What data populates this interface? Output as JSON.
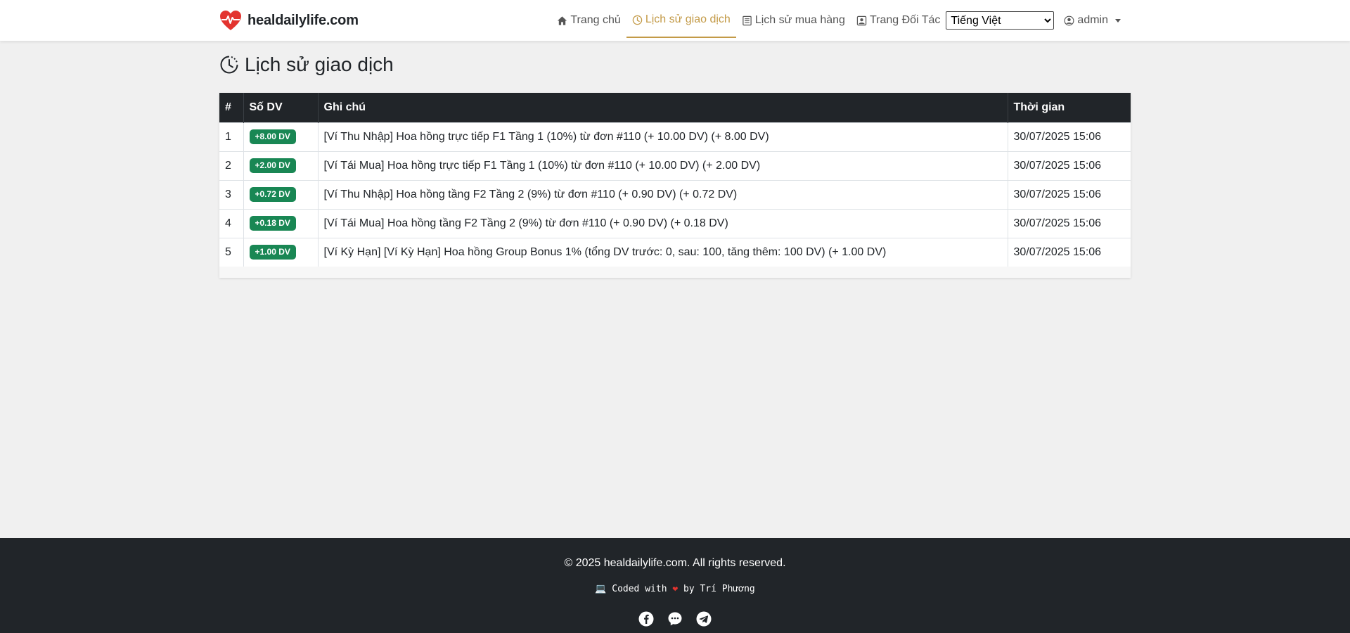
{
  "navbar": {
    "brand": "healdailylife.com",
    "links": [
      {
        "label": "Trang chủ",
        "icon": "home-icon"
      },
      {
        "label": "Lịch sử giao dịch",
        "icon": "clock-icon",
        "active": true
      },
      {
        "label": "Lịch sử mua hàng",
        "icon": "receipt-icon"
      },
      {
        "label": "Trang Đối Tác",
        "icon": "partner-icon"
      }
    ],
    "language": {
      "selected": "Tiếng Việt"
    },
    "user": {
      "label": "admin",
      "icon": "user-circle-icon"
    }
  },
  "page": {
    "title": "Lịch sử giao dịch",
    "title_icon": "clock-icon"
  },
  "table": {
    "headers": {
      "num": "#",
      "dv": "Số DV",
      "note": "Ghi chú",
      "time": "Thời gian"
    },
    "rows": [
      {
        "num": "1",
        "dv": "+8.00 DV",
        "note": "[Ví Thu Nhập] Hoa hồng trực tiếp F1 Tầng 1 (10%) từ đơn #110 (+ 10.00 DV) (+ 8.00 DV)",
        "time": "30/07/2025 15:06"
      },
      {
        "num": "2",
        "dv": "+2.00 DV",
        "note": "[Ví Tái Mua] Hoa hồng trực tiếp F1 Tầng 1 (10%) từ đơn #110 (+ 10.00 DV) (+ 2.00 DV)",
        "time": "30/07/2025 15:06"
      },
      {
        "num": "3",
        "dv": "+0.72 DV",
        "note": "[Ví Thu Nhập] Hoa hồng tầng F2 Tầng 2 (9%) từ đơn #110 (+ 0.90 DV) (+ 0.72 DV)",
        "time": "30/07/2025 15:06"
      },
      {
        "num": "4",
        "dv": "+0.18 DV",
        "note": "[Ví Tái Mua] Hoa hồng tầng F2 Tầng 2 (9%) từ đơn #110 (+ 0.90 DV) (+ 0.18 DV)",
        "time": "30/07/2025 15:06"
      },
      {
        "num": "5",
        "dv": "+1.00 DV",
        "note": "[Ví Kỳ Hạn] [Ví Kỳ Hạn] Hoa hồng Group Bonus 1% (tổng DV trước: 0, sau: 100, tăng thêm: 100 DV) (+ 1.00 DV)",
        "time": "30/07/2025 15:06"
      }
    ]
  },
  "footer": {
    "copyright": "© 2025 healdailylife.com. All rights reserved.",
    "coded_prefix": "💻 Coded with",
    "coded_suffix": "by Trí Phương",
    "socials": [
      "facebook-icon",
      "messenger-icon",
      "telegram-icon"
    ]
  },
  "colors": {
    "accent": "#c39a47",
    "badge": "#198754",
    "dark": "#212529",
    "brand_heart": "#e3342f"
  }
}
